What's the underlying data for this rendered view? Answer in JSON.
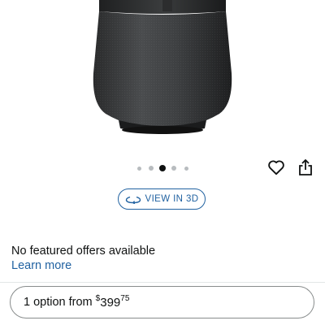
{
  "product_image": {
    "alt": "speaker-product-image"
  },
  "carousel": {
    "count": 5,
    "active_index": 2
  },
  "actions": {
    "wishlist_icon": "heart-icon",
    "share_icon": "share-icon"
  },
  "view_3d": {
    "label": "VIEW IN 3D",
    "icon": "rotate-3d-icon"
  },
  "offers": {
    "message": "No featured offers available",
    "link_label": "Learn more"
  },
  "option": {
    "prefix": "1 option from ",
    "currency": "$",
    "price_whole": "399",
    "price_fraction": "75"
  }
}
